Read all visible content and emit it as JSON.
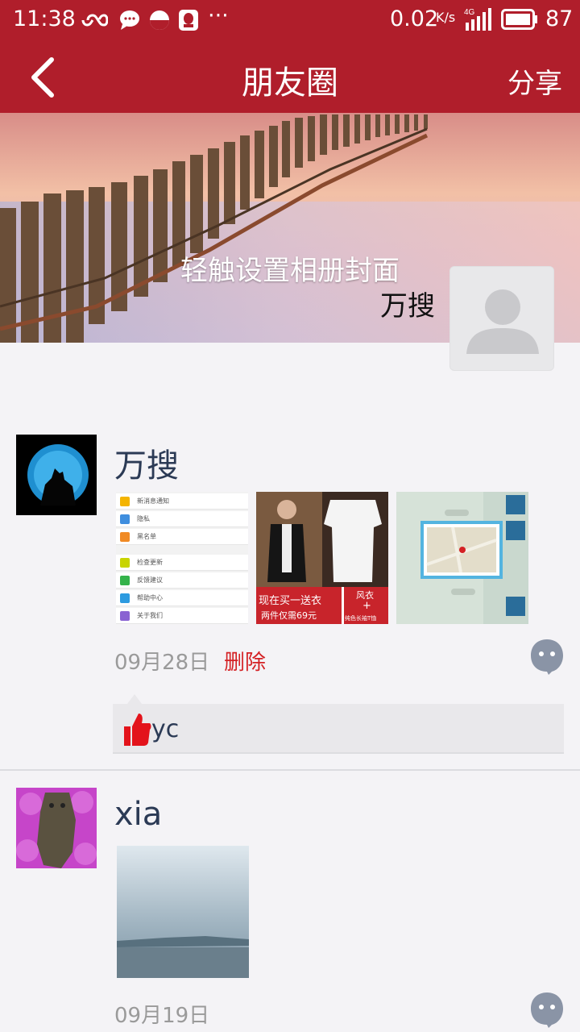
{
  "status_bar": {
    "time": "11:38",
    "net_speed": "0.02",
    "net_unit": "K/s",
    "signal": "4G",
    "battery": "87"
  },
  "header": {
    "title": "朋友圈",
    "share_label": "分享"
  },
  "cover": {
    "hint": "轻触设置相册封面",
    "owner_name": "万搜"
  },
  "posts": [
    {
      "author": "万搜",
      "date": "09月28日",
      "delete_label": "删除",
      "likes": [
        "yc"
      ],
      "images": [
        {
          "type": "settings-screenshot",
          "rows": [
            "新消息通知",
            "隐私",
            "黑名单",
            "检查更新",
            "反馈建议",
            "帮助中心",
            "关于我们"
          ]
        },
        {
          "type": "clothing-ad",
          "text_main_1": "现在买一送衣",
          "text_main_2": "两件仅需69元",
          "text_side_1": "风衣",
          "text_side_2": "+",
          "text_side_3": "纯色长袖T恤"
        },
        {
          "type": "map-screenshot"
        }
      ]
    },
    {
      "author": "xia",
      "date": "09月19日",
      "images": [
        {
          "type": "landscape-photo"
        }
      ]
    }
  ],
  "colors": {
    "brand_red": "#b01e2b",
    "delete_red": "#d42124",
    "name_blue": "#2b3a55",
    "date_gray": "#9a9a9a"
  }
}
